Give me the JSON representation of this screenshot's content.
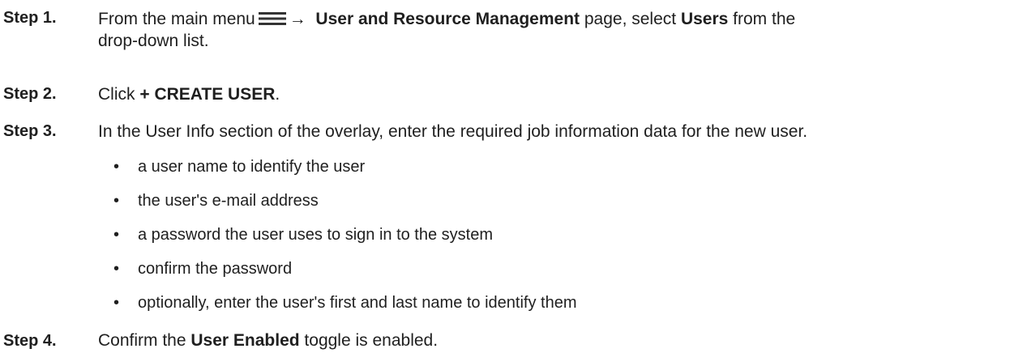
{
  "steps": [
    {
      "label": "Step 1.",
      "parts": {
        "a": "From the main menu",
        "arrow": "→",
        "b_bold": "User and Resource Management",
        "c": " page, select ",
        "d_bold": "Users",
        "e": " from the",
        "line2": "drop-down list."
      },
      "icon": "hamburger-menu-icon"
    },
    {
      "label": "Step 2.",
      "parts": {
        "a": "Click ",
        "b_bold": "+ CREATE USER",
        "c": "."
      }
    },
    {
      "label": "Step 3.",
      "text": "In the User Info section of the overlay, enter the required job information data for the new user.",
      "bullets": [
        "a user name to identify the user",
        "the user's e-mail address",
        "a password the user uses to sign in to the system",
        "confirm the password",
        "optionally, enter the user's first and last name to identify them"
      ]
    },
    {
      "label": "Step 4.",
      "parts": {
        "a": "Confirm the ",
        "b_bold": "User Enabled",
        "c": " toggle is enabled."
      }
    }
  ],
  "bullet_char": "•",
  "colors": {
    "text": "#1f1f1f",
    "icon": "#333333"
  }
}
